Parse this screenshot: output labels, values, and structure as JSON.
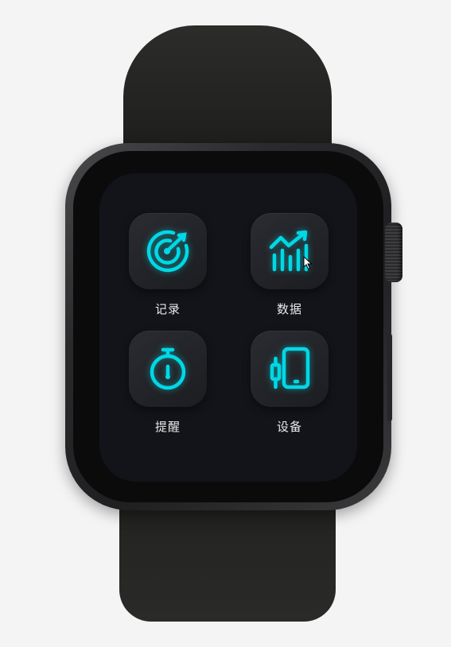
{
  "theme": {
    "accent": "#00d8e6",
    "screen_bg": "#121419",
    "tile_bg": "#24262b",
    "label_color": "#e8e8e8"
  },
  "apps": [
    {
      "label": "记录",
      "icon": "target-icon"
    },
    {
      "label": "数据",
      "icon": "chart-trend-icon"
    },
    {
      "label": "提醒",
      "icon": "stopwatch-icon"
    },
    {
      "label": "设备",
      "icon": "phone-device-icon"
    }
  ]
}
